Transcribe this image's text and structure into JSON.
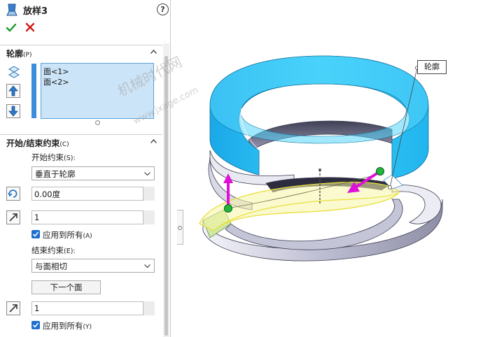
{
  "panel": {
    "title": "放样3",
    "help": "?",
    "ok": "OK",
    "cancel": "Cancel"
  },
  "profiles": {
    "header": "轮廓",
    "header_key": "(P)",
    "items": [
      "面<1>",
      "面<2>"
    ]
  },
  "constraints": {
    "header": "开始/结束约束",
    "header_key": "(C)",
    "start_label": "开始约束",
    "start_key": "(S):",
    "start_value": "垂直于轮廓",
    "angle_value": "0.00度",
    "start_length": "1",
    "start_apply_label": "应用到所有",
    "start_apply_key": "(A)",
    "start_apply_checked": true,
    "end_label": "结束约束",
    "end_key": "(E):",
    "end_value": "与面相切",
    "next_face": "下一个面",
    "end_length": "1",
    "end_apply_label": "应用到所有",
    "end_apply_key": "(Y)",
    "end_apply_checked": true
  },
  "viewport": {
    "callout": "轮廓",
    "watermark": "机械时代网",
    "watermark_url": "www.jxage.com"
  },
  "colors": {
    "accent": "#1f6fd0",
    "selection": "#cce4f7",
    "ring_top": "#33c9f5",
    "highlight": "#f3f05a",
    "arrow": "#e010d8",
    "handle": "#1fb83a",
    "ok": "#1a9a2a",
    "cancel": "#d21a1a"
  }
}
